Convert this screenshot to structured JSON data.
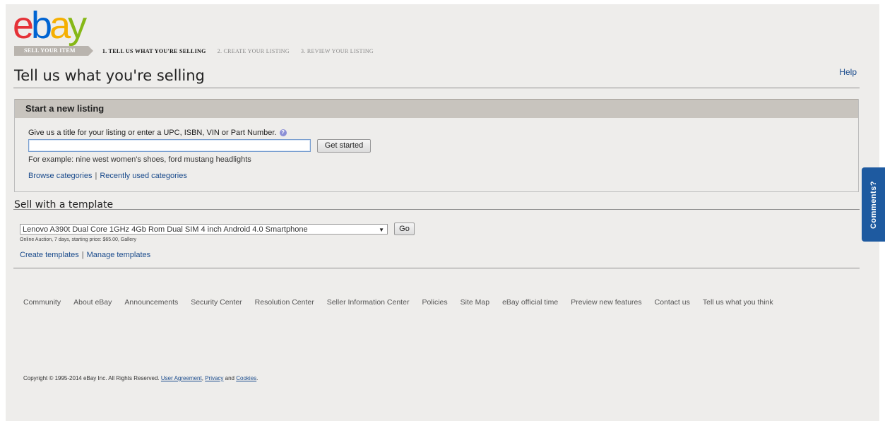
{
  "logo": {
    "letters": [
      "e",
      "b",
      "a",
      "y"
    ],
    "colors": [
      "#e53238",
      "#0064d2",
      "#f5af02",
      "#86b817"
    ]
  },
  "steps": {
    "current_label": "SELL YOUR ITEM",
    "items": [
      "1. TELL US WHAT YOU'RE SELLING",
      "2. CREATE YOUR LISTING",
      "3. REVIEW YOUR LISTING"
    ]
  },
  "page_title": "Tell us what you're selling",
  "help_label": "Help",
  "new_listing": {
    "header": "Start a new listing",
    "prompt": "Give us a title for your listing or enter a UPC, ISBN, VIN or Part Number.",
    "help_glyph": "?",
    "input_value": "",
    "button_label": "Get started",
    "example": "For example: nine west women's shoes, ford mustang headlights",
    "browse_label": "Browse categories",
    "recent_label": "Recently used categories",
    "separator": "|"
  },
  "template": {
    "heading": "Sell with a template",
    "selected": "Lenovo A390t Dual Core 1GHz 4Gb Rom Dual SIM 4 inch Android 4.0 Smartphone",
    "go_label": "Go",
    "details": "Online Auction, 7 days, starting price: $65.00, Gallery",
    "create_label": "Create templates",
    "manage_label": "Manage templates"
  },
  "footer": {
    "links": [
      "Community",
      "About eBay",
      "Announcements",
      "Security Center",
      "Resolution Center",
      "Seller Information Center",
      "Policies",
      "Site Map",
      "eBay official time",
      "Preview new features",
      "Contact us",
      "Tell us what you think"
    ],
    "copyright_prefix": "Copyright © 1995-2014 eBay Inc. All Rights Reserved.",
    "user_agreement": "User Agreement",
    "comma": ",",
    "privacy": "Privacy",
    "and": "and",
    "cookies": "Cookies",
    "period": "."
  },
  "comments_tab": {
    "label": "Comments?"
  },
  "colors": {
    "link": "#1a4b8c",
    "tab_blue": "#1e5aa0",
    "header_grey": "#c8c4be"
  }
}
